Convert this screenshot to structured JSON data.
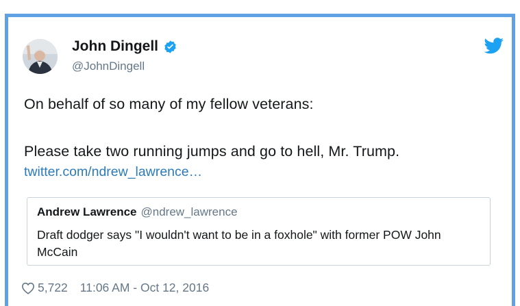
{
  "author": {
    "name": "John Dingell",
    "handle": "@JohnDingell"
  },
  "tweet": {
    "line1": "On behalf of so many of my fellow veterans:",
    "line2": "Please take two running jumps and go to hell, Mr. Trump.",
    "link": "twitter.com/ndrew_lawrence…"
  },
  "quoted_tweet": {
    "name": "Andrew Lawrence",
    "handle": "@ndrew_lawrence",
    "text": "Draft dodger says \"I wouldn't want to be in a foxhole\" with former POW John McCain"
  },
  "footer": {
    "likes": "5,722",
    "timestamp": "11:06 AM - Oct 12, 2016"
  },
  "icons": {
    "verified": "verified-badge-icon",
    "bird": "twitter-bird-icon",
    "heart": "heart-outline-icon"
  },
  "colors": {
    "frame_border": "#5fa1e3",
    "link": "#2b7bb9",
    "verified": "#1da1f2",
    "muted_text": "#657786"
  }
}
